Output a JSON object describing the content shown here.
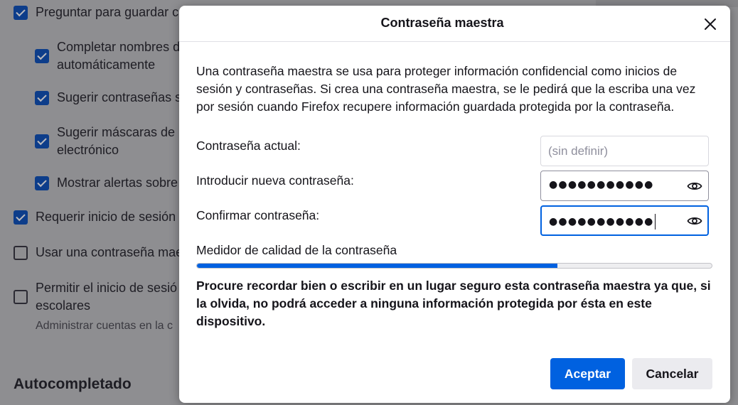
{
  "background": {
    "items": [
      {
        "label": "Preguntar para guardar c",
        "checked": true
      },
      {
        "label": "Completar nombres d",
        "label2": "automáticamente",
        "checked": true
      },
      {
        "label": "Sugerir contraseñas s",
        "checked": true
      },
      {
        "label": "Sugerir máscaras de",
        "label2": "electrónico",
        "checked": true
      },
      {
        "label": "Mostrar alertas sobre",
        "checked": true
      },
      {
        "label": "Requerir inicio de sesión",
        "checked": true
      },
      {
        "label": "Usar una contraseña mae",
        "checked": false
      },
      {
        "label": "Permitir el inicio de sesió",
        "label2": "escolares",
        "checked": false
      }
    ],
    "sub_text": "Administrar cuentas en la c",
    "heading": "Autocompletado"
  },
  "dialog": {
    "title": "Contraseña maestra",
    "description": "Una contraseña maestra se usa para proteger información confidencial como inicios de sesión y contraseñas. Si crea una contraseña maestra, se le pedirá que la escriba una vez por sesión cuando Firefox recupere información guardada protegida por la contraseña.",
    "current_label": "Contraseña actual:",
    "current_placeholder": "(sin definir)",
    "new_label": "Introducir nueva contraseña:",
    "new_value": "●●●●●●●●●●●",
    "confirm_label": "Confirmar contraseña:",
    "confirm_value": "●●●●●●●●●●●",
    "meter_label": "Medidor de calidad de la contraseña",
    "meter_fraction": 0.7,
    "warning": "Procure recordar bien o escribir en un lugar seguro esta contraseña maestra ya que, si la olvida, no podrá acceder a ninguna información protegida por ésta en este dispositivo.",
    "accept_label": "Aceptar",
    "cancel_label": "Cancelar"
  },
  "colors": {
    "accent": "#0061e0",
    "overlay_bg": "#8e8e91"
  },
  "icons": {
    "close": "close-icon",
    "reveal": "eye-icon"
  }
}
